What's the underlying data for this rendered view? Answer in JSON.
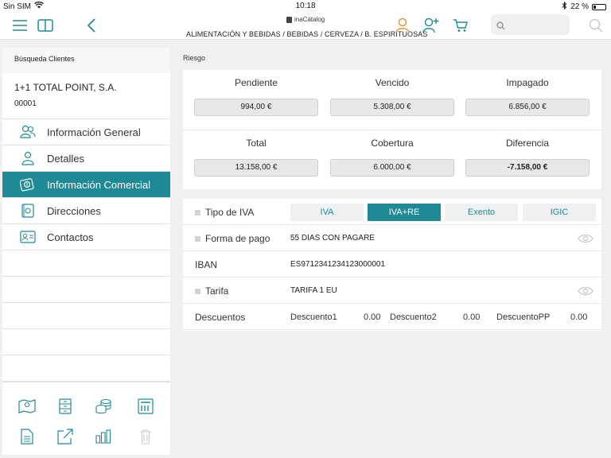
{
  "status_bar": {
    "carrier": "Sin SIM",
    "time": "10:18",
    "battery_percent": "22 %",
    "battery_level": 0.22
  },
  "nav": {
    "brand": "inaCátalog",
    "breadcrumb": "ALIMENTACIÓN Y BEBIDAS / BEBIDAS / CERVEZA / B. ESPIRITUOSAS",
    "search_placeholder": ""
  },
  "sidebar": {
    "search_clients_label": "Búsqueda Clientes",
    "client_name": "1+1 TOTAL POINT, S.A.",
    "client_code": "00001",
    "items": [
      {
        "label": "Información General",
        "icon": "users-icon"
      },
      {
        "label": "Detalles",
        "icon": "user-icon"
      },
      {
        "label": "Información Comercial",
        "icon": "commercial-icon",
        "active": true
      },
      {
        "label": "Direcciones",
        "icon": "address-icon"
      },
      {
        "label": "Contactos",
        "icon": "contact-card-icon"
      }
    ]
  },
  "risk": {
    "section_label": "Riesgo",
    "cells": [
      {
        "label": "Pendiente",
        "value": "994,00 €"
      },
      {
        "label": "Vencido",
        "value": "5.308,00 €"
      },
      {
        "label": "Impagado",
        "value": "6.856,00 €"
      },
      {
        "label": "Total",
        "value": "13.158,00 €"
      },
      {
        "label": "Cobertura",
        "value": "6.000,00 €"
      },
      {
        "label": "Diferencia",
        "value": "-7.158,00 €"
      }
    ]
  },
  "details": {
    "iva_label": "Tipo de IVA",
    "iva_options": [
      "IVA",
      "IVA+RE",
      "Exento",
      "IGIC"
    ],
    "iva_selected": "IVA+RE",
    "payment_label": "Forma de pago",
    "payment_value": "55 DIAS CON PAGARE",
    "iban_label": "IBAN",
    "iban_value": "ES9712341234123000001",
    "tariff_label": "Tarifa",
    "tariff_value": "TARIFA 1 EU",
    "discounts_label": "Descuentos",
    "discounts": [
      {
        "name": "Descuento1",
        "value": "0.00"
      },
      {
        "name": "Descuento2",
        "value": "0.00"
      },
      {
        "name": "DescuentoPP",
        "value": "0.00"
      }
    ]
  },
  "colors": {
    "accent": "#1f8a95",
    "cart_orange": "#e8922f"
  }
}
